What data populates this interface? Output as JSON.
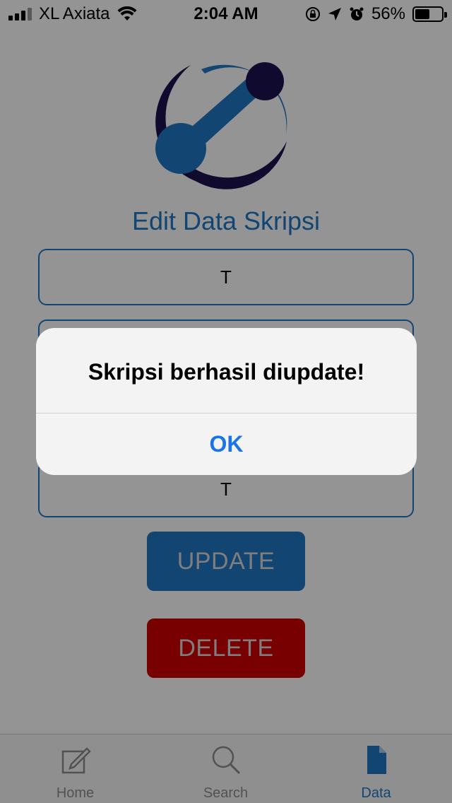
{
  "status_bar": {
    "carrier": "XL Axiata",
    "time": "2:04 AM",
    "battery": "56%",
    "battery_fraction": 0.56
  },
  "page": {
    "title": "Edit Data Skripsi",
    "fields": [
      {
        "value": "T"
      },
      {
        "value": ""
      },
      {
        "value": ""
      },
      {
        "value": "T"
      }
    ],
    "update_label": "UPDATE",
    "delete_label": "DELETE"
  },
  "tabs": [
    {
      "label": "Home",
      "icon": "edit-icon",
      "active": false
    },
    {
      "label": "Search",
      "icon": "search-icon",
      "active": false
    },
    {
      "label": "Data",
      "icon": "document-icon",
      "active": true
    }
  ],
  "alert": {
    "message": "Skripsi berhasil diupdate!",
    "ok_label": "OK"
  },
  "colors": {
    "accent": "#1f78c4",
    "delete": "#d10000",
    "alert_button": "#1a73e8"
  }
}
